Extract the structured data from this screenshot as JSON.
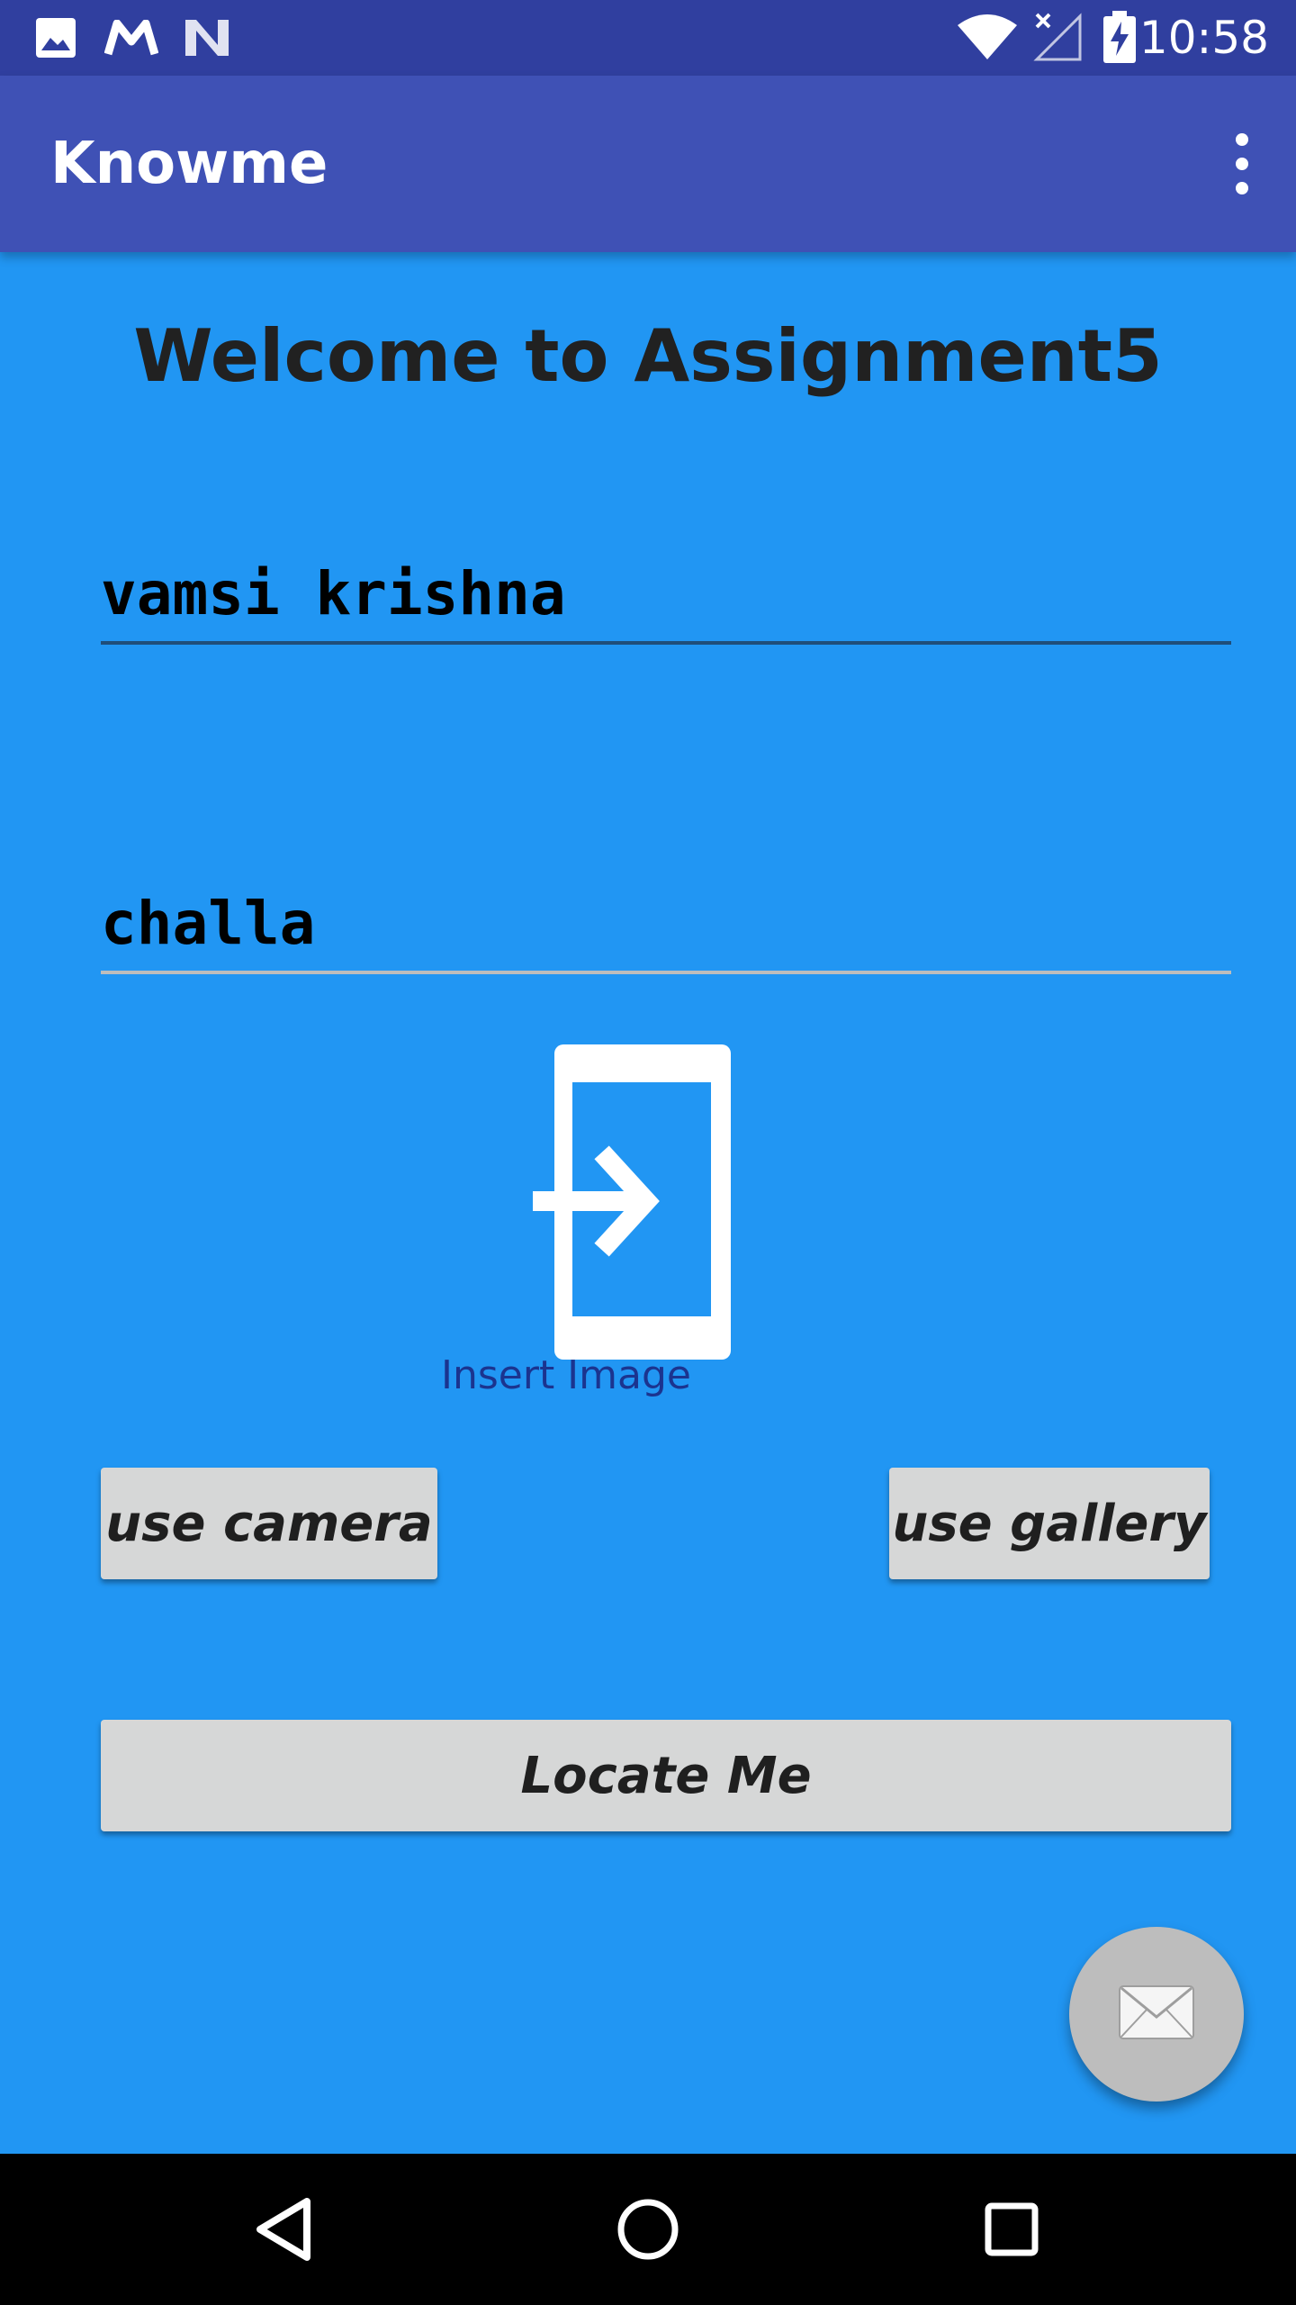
{
  "status_bar": {
    "time": "10:58",
    "left_icons": [
      "image-icon",
      "gmail-m-icon",
      "n-icon"
    ],
    "right_icons": [
      "wifi-icon",
      "no-signal-icon",
      "battery-charging-icon"
    ]
  },
  "app_bar": {
    "title": "Knowme",
    "overflow_icon": "more-vert-icon"
  },
  "main": {
    "welcome": "Welcome to Assignment5",
    "first_name_value": "vamsi krishna",
    "last_name_value": "challa",
    "image_icon": "insert-image-icon",
    "insert_image_label": "Insert Image",
    "camera_button": "use camera",
    "gallery_button": "use gallery",
    "locate_button": "Locate Me",
    "fab_icon": "envelope-icon"
  },
  "nav_bar": {
    "icons": [
      "back-icon",
      "home-icon",
      "recents-icon"
    ]
  },
  "colors": {
    "status_bar": "#303f9f",
    "app_bar": "#3f51b5",
    "background": "#2196f3",
    "button": "#d6d7d7",
    "fab": "#bdbdbd"
  }
}
